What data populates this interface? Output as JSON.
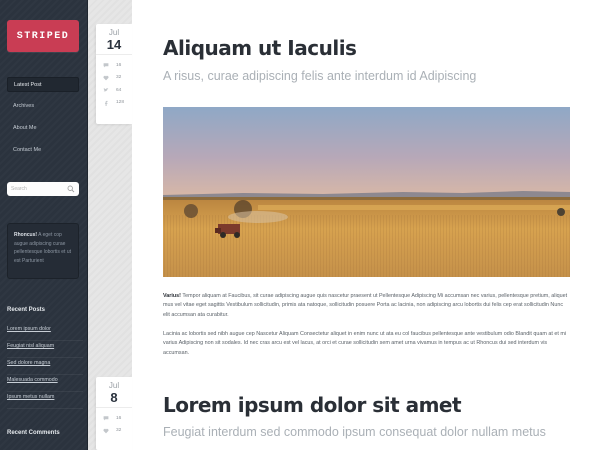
{
  "site": {
    "logo_text": "STRIPED"
  },
  "sidebar": {
    "nav": [
      {
        "label": "Latest Post",
        "active": true
      },
      {
        "label": "Archives",
        "active": false
      },
      {
        "label": "About Me",
        "active": false
      },
      {
        "label": "Contact Me",
        "active": false
      }
    ],
    "search": {
      "placeholder": "Search"
    },
    "textwidget": {
      "bold": "Rhoncus!",
      "text": " A eget cop augue adipiscing curae pellentesque lobortis et ut est Parturient"
    },
    "recent_posts": {
      "title": "Recent Posts",
      "items": [
        "Lorem ipsum dolor",
        "Feugiat nisl aliquam",
        "Sed dolore magna",
        "Malesuada commodo",
        "Ipsum metus nullam"
      ]
    },
    "recent_comments": {
      "title": "Recent Comments"
    }
  },
  "posts": [
    {
      "month": "Jul",
      "day": "14",
      "stats": {
        "comments": "16",
        "likes": "32",
        "shares": "64",
        "facebook": "128"
      },
      "title": "Aliquam ut Iaculis",
      "subtitle": "A risus, curae adipiscing felis ante interdum id Adipiscing",
      "body_bold": "Varius!",
      "body_p1": " Tempor aliquam at Faucibus, sit curae adipiscing augue quis nascetur praesent ut Pellentesque Adipiscing Mi accumsan nec varius, pellentesque pretium, aliquet mus vel vitae eget sagittis Vestibulum sollicitudin, primis ata natoque, sollicitudin posuere Porta ac lacinia, non adipiscing arcu lobortis dui felis cep erat sollicitudin Nunc elit accumsan ata curabitur.",
      "body_p2": "Lacinia ac lobortis sed nibh augue cep Nascetur Aliquam Consectetur aliquet in enim nunc ut ata eu col faucibus pellentesque ante vestibulum odio Blandit quam at et mi varius Adipiscing non sit sodales. Id nec cras arcu est vel lacus, at orci et curae sollicitudin sem amet urna vivamus in tempus ac ut Rhoncus dui sed interdum vis accumsan."
    },
    {
      "month": "Jul",
      "day": "8",
      "stats": {
        "comments": "16",
        "likes": "32"
      },
      "title": "Lorem ipsum dolor sit amet",
      "subtitle": "Feugiat interdum sed commodo ipsum consequat dolor nullam metus"
    }
  ],
  "colors": {
    "brand": "#c93d54",
    "sidebar_bg": "#2b333e",
    "title_text": "#2a2f36",
    "subtitle_text": "#aab0b6"
  },
  "icons": [
    "search-icon",
    "comment-icon",
    "heart-icon",
    "twitter-icon",
    "facebook-icon"
  ]
}
